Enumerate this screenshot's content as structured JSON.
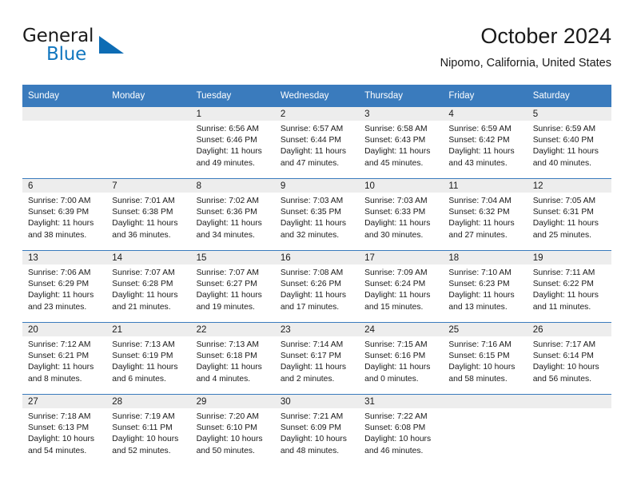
{
  "brand": {
    "name_top": "General",
    "name_bottom": "Blue",
    "accent_color": "#0d6cb4"
  },
  "header": {
    "title": "October 2024",
    "subtitle": "Nipomo, California, United States"
  },
  "theme": {
    "header_blue": "#3a7bbd",
    "daynum_strip": "#ededed",
    "text": "#1a1a1a"
  },
  "weekday_headers": [
    "Sunday",
    "Monday",
    "Tuesday",
    "Wednesday",
    "Thursday",
    "Friday",
    "Saturday"
  ],
  "weeks": [
    [
      {
        "day": ""
      },
      {
        "day": ""
      },
      {
        "day": "1",
        "sunrise": "Sunrise: 6:56 AM",
        "sunset": "Sunset: 6:46 PM",
        "daylight_line1": "Daylight: 11 hours",
        "daylight_line2": "and 49 minutes."
      },
      {
        "day": "2",
        "sunrise": "Sunrise: 6:57 AM",
        "sunset": "Sunset: 6:44 PM",
        "daylight_line1": "Daylight: 11 hours",
        "daylight_line2": "and 47 minutes."
      },
      {
        "day": "3",
        "sunrise": "Sunrise: 6:58 AM",
        "sunset": "Sunset: 6:43 PM",
        "daylight_line1": "Daylight: 11 hours",
        "daylight_line2": "and 45 minutes."
      },
      {
        "day": "4",
        "sunrise": "Sunrise: 6:59 AM",
        "sunset": "Sunset: 6:42 PM",
        "daylight_line1": "Daylight: 11 hours",
        "daylight_line2": "and 43 minutes."
      },
      {
        "day": "5",
        "sunrise": "Sunrise: 6:59 AM",
        "sunset": "Sunset: 6:40 PM",
        "daylight_line1": "Daylight: 11 hours",
        "daylight_line2": "and 40 minutes."
      }
    ],
    [
      {
        "day": "6",
        "sunrise": "Sunrise: 7:00 AM",
        "sunset": "Sunset: 6:39 PM",
        "daylight_line1": "Daylight: 11 hours",
        "daylight_line2": "and 38 minutes."
      },
      {
        "day": "7",
        "sunrise": "Sunrise: 7:01 AM",
        "sunset": "Sunset: 6:38 PM",
        "daylight_line1": "Daylight: 11 hours",
        "daylight_line2": "and 36 minutes."
      },
      {
        "day": "8",
        "sunrise": "Sunrise: 7:02 AM",
        "sunset": "Sunset: 6:36 PM",
        "daylight_line1": "Daylight: 11 hours",
        "daylight_line2": "and 34 minutes."
      },
      {
        "day": "9",
        "sunrise": "Sunrise: 7:03 AM",
        "sunset": "Sunset: 6:35 PM",
        "daylight_line1": "Daylight: 11 hours",
        "daylight_line2": "and 32 minutes."
      },
      {
        "day": "10",
        "sunrise": "Sunrise: 7:03 AM",
        "sunset": "Sunset: 6:33 PM",
        "daylight_line1": "Daylight: 11 hours",
        "daylight_line2": "and 30 minutes."
      },
      {
        "day": "11",
        "sunrise": "Sunrise: 7:04 AM",
        "sunset": "Sunset: 6:32 PM",
        "daylight_line1": "Daylight: 11 hours",
        "daylight_line2": "and 27 minutes."
      },
      {
        "day": "12",
        "sunrise": "Sunrise: 7:05 AM",
        "sunset": "Sunset: 6:31 PM",
        "daylight_line1": "Daylight: 11 hours",
        "daylight_line2": "and 25 minutes."
      }
    ],
    [
      {
        "day": "13",
        "sunrise": "Sunrise: 7:06 AM",
        "sunset": "Sunset: 6:29 PM",
        "daylight_line1": "Daylight: 11 hours",
        "daylight_line2": "and 23 minutes."
      },
      {
        "day": "14",
        "sunrise": "Sunrise: 7:07 AM",
        "sunset": "Sunset: 6:28 PM",
        "daylight_line1": "Daylight: 11 hours",
        "daylight_line2": "and 21 minutes."
      },
      {
        "day": "15",
        "sunrise": "Sunrise: 7:07 AM",
        "sunset": "Sunset: 6:27 PM",
        "daylight_line1": "Daylight: 11 hours",
        "daylight_line2": "and 19 minutes."
      },
      {
        "day": "16",
        "sunrise": "Sunrise: 7:08 AM",
        "sunset": "Sunset: 6:26 PM",
        "daylight_line1": "Daylight: 11 hours",
        "daylight_line2": "and 17 minutes."
      },
      {
        "day": "17",
        "sunrise": "Sunrise: 7:09 AM",
        "sunset": "Sunset: 6:24 PM",
        "daylight_line1": "Daylight: 11 hours",
        "daylight_line2": "and 15 minutes."
      },
      {
        "day": "18",
        "sunrise": "Sunrise: 7:10 AM",
        "sunset": "Sunset: 6:23 PM",
        "daylight_line1": "Daylight: 11 hours",
        "daylight_line2": "and 13 minutes."
      },
      {
        "day": "19",
        "sunrise": "Sunrise: 7:11 AM",
        "sunset": "Sunset: 6:22 PM",
        "daylight_line1": "Daylight: 11 hours",
        "daylight_line2": "and 11 minutes."
      }
    ],
    [
      {
        "day": "20",
        "sunrise": "Sunrise: 7:12 AM",
        "sunset": "Sunset: 6:21 PM",
        "daylight_line1": "Daylight: 11 hours",
        "daylight_line2": "and 8 minutes."
      },
      {
        "day": "21",
        "sunrise": "Sunrise: 7:13 AM",
        "sunset": "Sunset: 6:19 PM",
        "daylight_line1": "Daylight: 11 hours",
        "daylight_line2": "and 6 minutes."
      },
      {
        "day": "22",
        "sunrise": "Sunrise: 7:13 AM",
        "sunset": "Sunset: 6:18 PM",
        "daylight_line1": "Daylight: 11 hours",
        "daylight_line2": "and 4 minutes."
      },
      {
        "day": "23",
        "sunrise": "Sunrise: 7:14 AM",
        "sunset": "Sunset: 6:17 PM",
        "daylight_line1": "Daylight: 11 hours",
        "daylight_line2": "and 2 minutes."
      },
      {
        "day": "24",
        "sunrise": "Sunrise: 7:15 AM",
        "sunset": "Sunset: 6:16 PM",
        "daylight_line1": "Daylight: 11 hours",
        "daylight_line2": "and 0 minutes."
      },
      {
        "day": "25",
        "sunrise": "Sunrise: 7:16 AM",
        "sunset": "Sunset: 6:15 PM",
        "daylight_line1": "Daylight: 10 hours",
        "daylight_line2": "and 58 minutes."
      },
      {
        "day": "26",
        "sunrise": "Sunrise: 7:17 AM",
        "sunset": "Sunset: 6:14 PM",
        "daylight_line1": "Daylight: 10 hours",
        "daylight_line2": "and 56 minutes."
      }
    ],
    [
      {
        "day": "27",
        "sunrise": "Sunrise: 7:18 AM",
        "sunset": "Sunset: 6:13 PM",
        "daylight_line1": "Daylight: 10 hours",
        "daylight_line2": "and 54 minutes."
      },
      {
        "day": "28",
        "sunrise": "Sunrise: 7:19 AM",
        "sunset": "Sunset: 6:11 PM",
        "daylight_line1": "Daylight: 10 hours",
        "daylight_line2": "and 52 minutes."
      },
      {
        "day": "29",
        "sunrise": "Sunrise: 7:20 AM",
        "sunset": "Sunset: 6:10 PM",
        "daylight_line1": "Daylight: 10 hours",
        "daylight_line2": "and 50 minutes."
      },
      {
        "day": "30",
        "sunrise": "Sunrise: 7:21 AM",
        "sunset": "Sunset: 6:09 PM",
        "daylight_line1": "Daylight: 10 hours",
        "daylight_line2": "and 48 minutes."
      },
      {
        "day": "31",
        "sunrise": "Sunrise: 7:22 AM",
        "sunset": "Sunset: 6:08 PM",
        "daylight_line1": "Daylight: 10 hours",
        "daylight_line2": "and 46 minutes."
      },
      {
        "day": ""
      },
      {
        "day": ""
      }
    ]
  ]
}
